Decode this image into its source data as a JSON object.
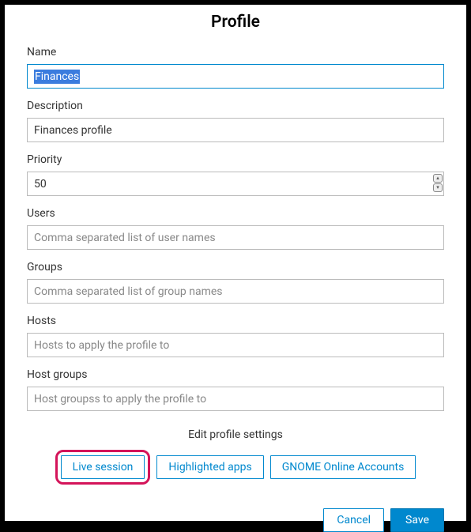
{
  "title": "Profile",
  "fields": {
    "name": {
      "label": "Name",
      "value": "Finances"
    },
    "description": {
      "label": "Description",
      "value": "Finances profile"
    },
    "priority": {
      "label": "Priority",
      "value": "50"
    },
    "users": {
      "label": "Users",
      "placeholder": "Comma separated list of user names"
    },
    "groups": {
      "label": "Groups",
      "placeholder": "Comma separated list of group names"
    },
    "hosts": {
      "label": "Hosts",
      "placeholder": "Hosts to apply the profile to"
    },
    "hostgroups": {
      "label": "Host groups",
      "placeholder": "Host groupss to apply the profile to"
    }
  },
  "settings": {
    "label": "Edit profile settings",
    "buttons": {
      "live": "Live session",
      "highlighted": "Highlighted apps",
      "goa": "GNOME Online Accounts"
    }
  },
  "footer": {
    "cancel": "Cancel",
    "save": "Save"
  }
}
